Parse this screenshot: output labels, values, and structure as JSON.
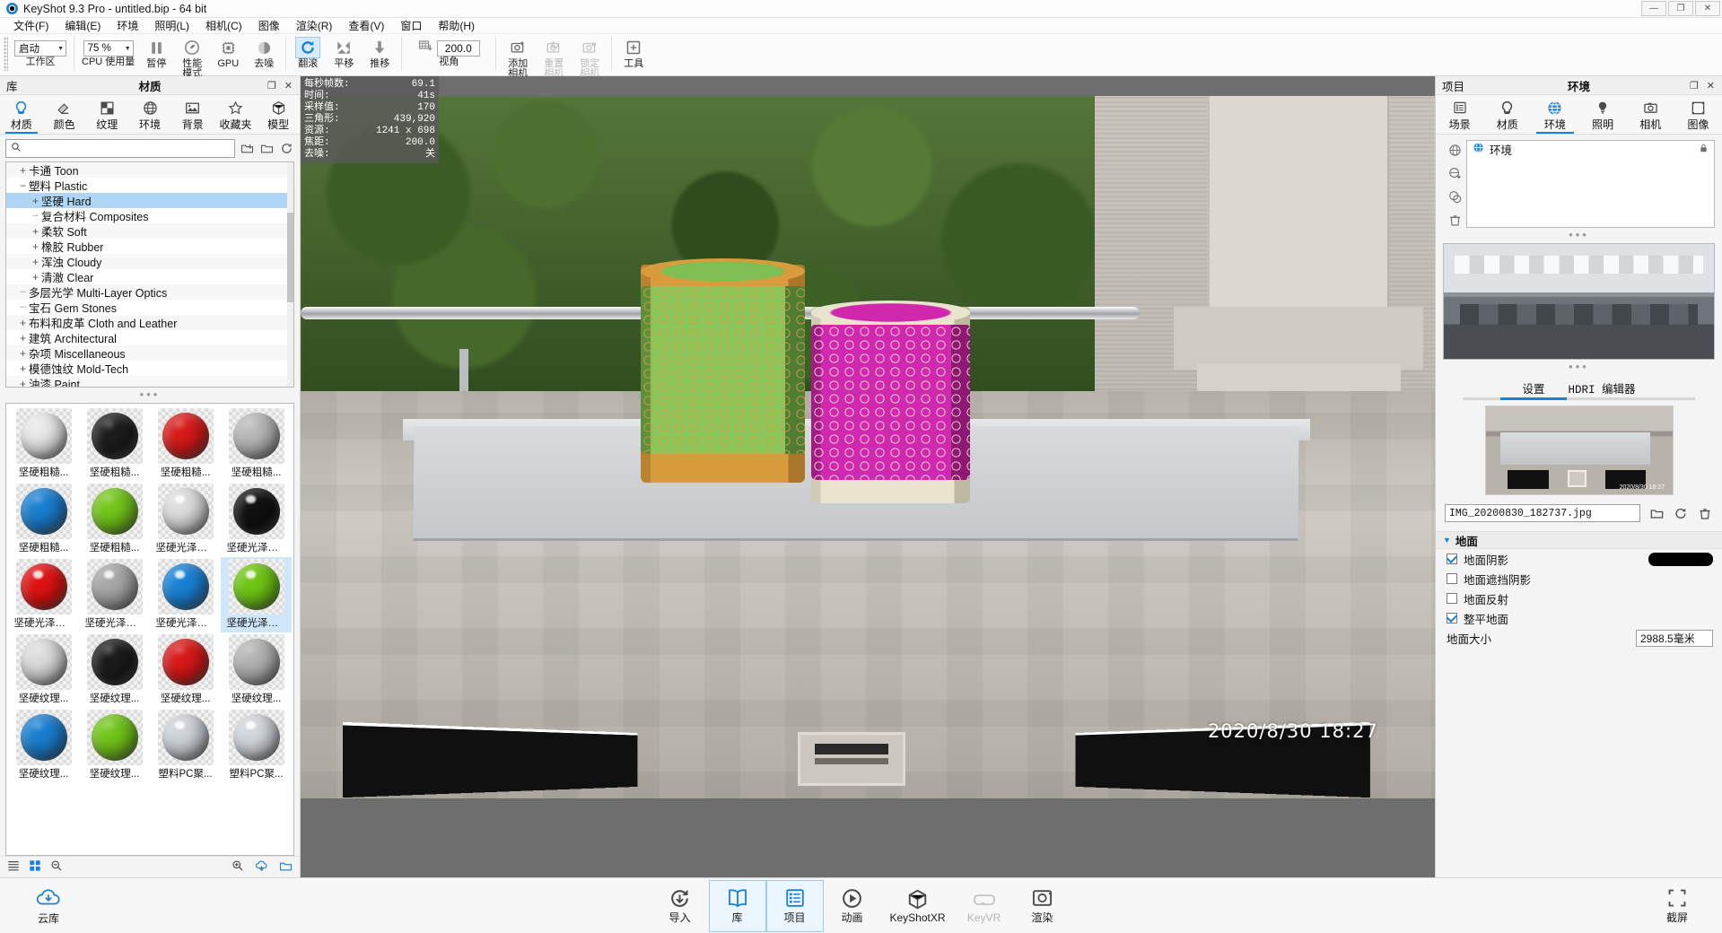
{
  "window": {
    "title": "KeyShot 9.3 Pro  - untitled.bip  - 64 bit",
    "minimize": "—",
    "maximize": "❐",
    "close": "✕"
  },
  "menubar": [
    {
      "label": "文件(F)"
    },
    {
      "label": "编辑(E)"
    },
    {
      "label": "环境"
    },
    {
      "label": "照明(L)"
    },
    {
      "label": "相机(C)"
    },
    {
      "label": "图像"
    },
    {
      "label": "渲染(R)"
    },
    {
      "label": "查看(V)"
    },
    {
      "label": "窗口"
    },
    {
      "label": "帮助(H)"
    }
  ],
  "toolbar": {
    "workspace_value": "启动",
    "workspace_label": "工作区",
    "cpu_value": "75 %",
    "cpu_label": "CPU 使用量",
    "pause_label": "暂停",
    "perf_label_1": "性能",
    "perf_label_2": "模式",
    "gpu_label": "GPU",
    "denoise_label": "去噪",
    "roll_label": "翻滚",
    "pan_label": "平移",
    "dolly_label": "推移",
    "fov_value": "200.0",
    "fov_label": "视角",
    "add_camera_1": "添加",
    "add_camera_2": "相机",
    "reset_camera_1": "重置",
    "reset_camera_2": "相机",
    "lock_camera_1": "锁定",
    "lock_camera_2": "相机",
    "tools_label": "工具"
  },
  "library": {
    "head_left": "库",
    "head_center": "材质",
    "tabs": [
      {
        "label": "材质",
        "icon": "material-icon",
        "selected": true
      },
      {
        "label": "颜色",
        "icon": "color-icon",
        "selected": false
      },
      {
        "label": "纹理",
        "icon": "texture-icon",
        "selected": false
      },
      {
        "label": "环境",
        "icon": "environment-icon",
        "selected": false
      },
      {
        "label": "背景",
        "icon": "backplate-icon",
        "selected": false
      },
      {
        "label": "收藏夹",
        "icon": "favorites-icon",
        "selected": false
      },
      {
        "label": "模型",
        "icon": "model-icon",
        "selected": false
      }
    ],
    "search_placeholder": "",
    "search_value": "",
    "tree": [
      {
        "label": "卡通 Toon",
        "expander": "+",
        "level": 1,
        "selected": false
      },
      {
        "label": "塑料 Plastic",
        "expander": "−",
        "level": 1,
        "selected": false
      },
      {
        "label": "坚硬 Hard",
        "expander": "+",
        "level": 2,
        "selected": true
      },
      {
        "label": "复合材料 Composites",
        "expander": "",
        "level": 2,
        "selected": false
      },
      {
        "label": "柔软 Soft",
        "expander": "+",
        "level": 2,
        "selected": false
      },
      {
        "label": "橡胶 Rubber",
        "expander": "+",
        "level": 2,
        "selected": false
      },
      {
        "label": "浑浊 Cloudy",
        "expander": "+",
        "level": 2,
        "selected": false
      },
      {
        "label": "清澈 Clear",
        "expander": "+",
        "level": 2,
        "selected": false
      },
      {
        "label": "多层光学 Multi-Layer Optics",
        "expander": "",
        "level": 1,
        "selected": false
      },
      {
        "label": "宝石 Gem Stones",
        "expander": "",
        "level": 1,
        "selected": false
      },
      {
        "label": "布料和皮革 Cloth and Leather",
        "expander": "+",
        "level": 1,
        "selected": false
      },
      {
        "label": "建筑 Architectural",
        "expander": "+",
        "level": 1,
        "selected": false
      },
      {
        "label": "杂项 Miscellaneous",
        "expander": "+",
        "level": 1,
        "selected": false
      },
      {
        "label": "模德蚀纹 Mold-Tech",
        "expander": "+",
        "level": 1,
        "selected": false
      },
      {
        "label": "油漆 Paint",
        "expander": "+",
        "level": 1,
        "selected": false
      }
    ],
    "materials": [
      {
        "label": "坚硬粗糙...",
        "color": "#e8e8e8",
        "finish": "matte",
        "selected": false
      },
      {
        "label": "坚硬粗糙...",
        "color": "#1d1d1d",
        "finish": "matte",
        "selected": false
      },
      {
        "label": "坚硬粗糙...",
        "color": "#d81a1a",
        "finish": "matte",
        "selected": false
      },
      {
        "label": "坚硬粗糙...",
        "color": "#b9b9b9",
        "finish": "matte",
        "selected": false
      },
      {
        "label": "坚硬粗糙...",
        "color": "#1a7fd0",
        "finish": "matte",
        "selected": false
      },
      {
        "label": "坚硬粗糙...",
        "color": "#73c61b",
        "finish": "matte",
        "selected": false
      },
      {
        "label": "坚硬光泽塑...",
        "color": "#dedede",
        "finish": "gloss",
        "selected": false
      },
      {
        "label": "坚硬光泽塑...",
        "color": "#101010",
        "finish": "gloss",
        "selected": false
      },
      {
        "label": "坚硬光泽塑...",
        "color": "#e01212",
        "finish": "gloss",
        "selected": false
      },
      {
        "label": "坚硬光泽塑...",
        "color": "#a8a8a8",
        "finish": "gloss",
        "selected": false
      },
      {
        "label": "坚硬光泽塑...",
        "color": "#1a82d6",
        "finish": "gloss",
        "selected": false
      },
      {
        "label": "坚硬光泽塑...",
        "color": "#6fc714",
        "finish": "gloss",
        "selected": true
      },
      {
        "label": "坚硬纹理...",
        "color": "#dcdcdc",
        "finish": "matte",
        "selected": false
      },
      {
        "label": "坚硬纹理...",
        "color": "#1b1b1b",
        "finish": "matte",
        "selected": false
      },
      {
        "label": "坚硬纹理...",
        "color": "#d81818",
        "finish": "matte",
        "selected": false
      },
      {
        "label": "坚硬纹理...",
        "color": "#b4b4b4",
        "finish": "matte",
        "selected": false
      },
      {
        "label": "坚硬纹理...",
        "color": "#1a7fd0",
        "finish": "matte",
        "selected": false
      },
      {
        "label": "坚硬纹理...",
        "color": "#72c51a",
        "finish": "matte",
        "selected": false
      },
      {
        "label": "塑料PC聚...",
        "color": "#cfd4d8",
        "finish": "clear",
        "selected": false
      },
      {
        "label": "塑料PC聚...",
        "color": "#d2d7db",
        "finish": "clear",
        "selected": false
      }
    ],
    "footer_icons": [
      "list-view-icon",
      "grid-view-icon",
      "zoom-out-icon",
      "zoom-in-icon",
      "download-icon",
      "folder-icon"
    ]
  },
  "hud": {
    "rows": [
      {
        "key": "每秒帧数:",
        "value": "69.1"
      },
      {
        "key": "时间:",
        "value": "41s"
      },
      {
        "key": "采样值:",
        "value": "170"
      },
      {
        "key": "三角形:",
        "value": "439,920"
      },
      {
        "key": "资源:",
        "value": "1241 x 698"
      },
      {
        "key": "焦距:",
        "value": "200.0"
      },
      {
        "key": "去噪:",
        "value": "关"
      }
    ]
  },
  "viewport": {
    "timestamp": "2020/8/30  18:27"
  },
  "project": {
    "head_left": "项目",
    "head_center": "环境",
    "tabs": [
      {
        "label": "场景",
        "icon": "scene-tree-icon",
        "selected": false
      },
      {
        "label": "材质",
        "icon": "material-icon",
        "selected": false
      },
      {
        "label": "环境",
        "icon": "environment-icon",
        "selected": true
      },
      {
        "label": "照明",
        "icon": "lighting-icon",
        "selected": false
      },
      {
        "label": "相机",
        "icon": "camera-icon",
        "selected": false
      },
      {
        "label": "图像",
        "icon": "image-icon",
        "selected": false
      }
    ],
    "list_item": "环境",
    "list_lock_icon": "lock-icon",
    "side_buttons": [
      "globe-icon",
      "globe-add-icon",
      "globe-dup-icon",
      "trash-icon"
    ],
    "subtabs": [
      {
        "label": "设置",
        "selected": true
      },
      {
        "label": "HDRI 编辑器",
        "selected": false
      }
    ],
    "hdri_file": "IMG_20200830_182737.jpg",
    "file_buttons": [
      "folder-open-icon",
      "refresh-icon",
      "trash-icon"
    ],
    "ground": {
      "section_title": "地面",
      "rows": [
        {
          "label": "地面阴影",
          "checked": true,
          "control": "color",
          "color": "#000000"
        },
        {
          "label": "地面遮挡阴影",
          "checked": false,
          "control": "none"
        },
        {
          "label": "地面反射",
          "checked": false,
          "control": "none"
        },
        {
          "label": "整平地面",
          "checked": true,
          "control": "none"
        }
      ],
      "size_label": "地面大小",
      "size_value": "2988.5毫米"
    }
  },
  "bottombar": {
    "cloud_label": "云库",
    "items": [
      {
        "label": "导入",
        "icon": "import-icon",
        "active": false,
        "dim": false
      },
      {
        "label": "库",
        "icon": "library-icon",
        "active": true,
        "dim": false
      },
      {
        "label": "项目",
        "icon": "project-icon",
        "active": true,
        "dim": false
      },
      {
        "label": "动画",
        "icon": "animation-icon",
        "active": false,
        "dim": false
      },
      {
        "label": "KeyShotXR",
        "icon": "keyshotxr-icon",
        "active": false,
        "dim": false
      },
      {
        "label": "KeyVR",
        "icon": "keyvr-icon",
        "active": false,
        "dim": true
      },
      {
        "label": "渲染",
        "icon": "render-icon",
        "active": false,
        "dim": false
      }
    ],
    "fullscreen_label": "截屏"
  }
}
